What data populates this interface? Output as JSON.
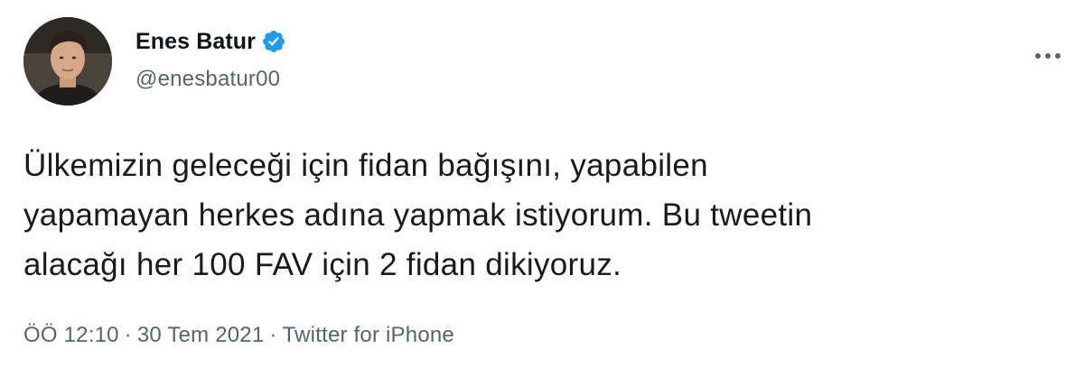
{
  "tweet": {
    "author": {
      "display_name": "Enes Batur",
      "handle": "@enesbatur00",
      "verified": true
    },
    "text": "Ülkemizin geleceği için fidan bağışını, yapabilen\nyapamayan herkes adına yapmak istiyorum. Bu tweetin\nalacağı her 100 FAV için 2 fidan dikiyoruz.",
    "meta": {
      "time": "ÖÖ 12:10",
      "separator": "·",
      "date": "30 Tem 2021",
      "source": "Twitter for iPhone"
    },
    "icons": {
      "verified": "verified-badge-icon",
      "more": "more-icon"
    },
    "colors": {
      "verified_blue": "#1d9bf0",
      "secondary_text": "#536471",
      "primary_text": "#0f1419"
    }
  }
}
